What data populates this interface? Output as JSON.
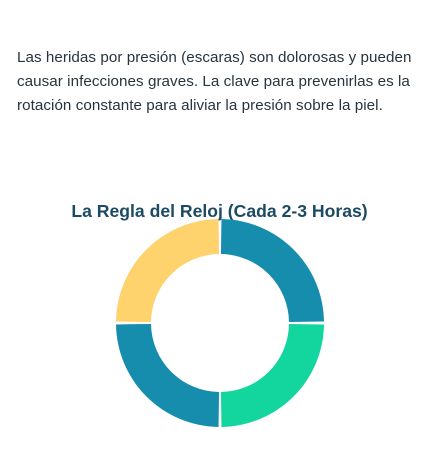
{
  "intro_text": "Las heridas por presión (escaras) son dolorosas y pueden causar infecciones graves. La clave para prevenirlas es la rotación constante para aliviar la presión sobre la piel.",
  "chart_data": {
    "type": "pie",
    "style": "donut",
    "title": "La Regla del Reloj (Cada 2-3 Horas)",
    "categories": [
      "",
      "",
      "",
      ""
    ],
    "values": [
      25,
      25,
      25,
      25
    ],
    "colors": [
      "#168dad",
      "#12d69e",
      "#168dad",
      "#fed26c"
    ],
    "start": "top",
    "direction": "clockwise",
    "legend": "none"
  }
}
